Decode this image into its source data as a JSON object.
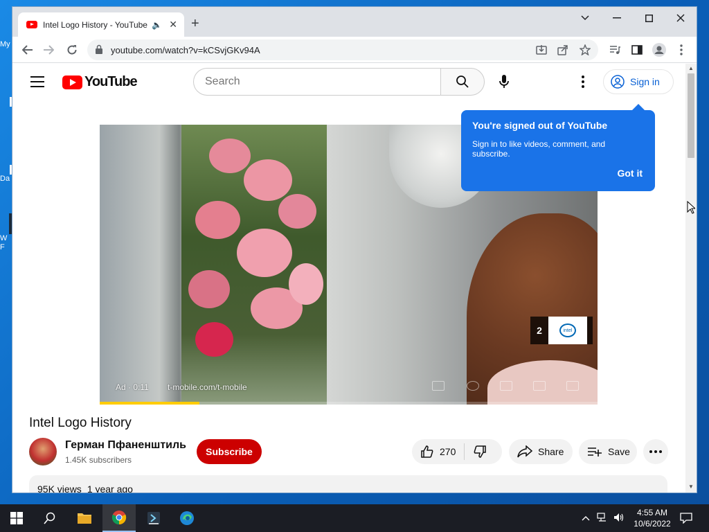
{
  "browser": {
    "tab_title": "Intel Logo History - YouTube",
    "new_tab": "+",
    "url": "youtube.com/watch?v=kCSvjGKv94A"
  },
  "youtube": {
    "logo_text": "YouTube",
    "search_placeholder": "Search",
    "sign_in": "Sign in",
    "popup": {
      "title": "You're signed out of YouTube",
      "body": "Sign in to like videos, comment, and subscribe.",
      "button": "Got it"
    },
    "ad": {
      "label": "Ad · 0:11",
      "link": "t-mobile.com/t-mobile",
      "count": "2",
      "progress_fraction": 0.2
    },
    "video": {
      "title": "Intel Logo History",
      "channel": "Герман Пфаненштиль",
      "subscribers": "1.45K subscribers",
      "subscribe": "Subscribe",
      "likes": "270",
      "share": "Share",
      "save": "Save",
      "views": "95K views",
      "age": "1 year ago"
    }
  },
  "taskbar": {
    "time": "4:55 AM",
    "date": "10/6/2022"
  },
  "colors": {
    "youtube_red": "#ff0000",
    "subscribe_red": "#cc0000",
    "popup_blue": "#1a73e8",
    "link_blue": "#065fd4"
  }
}
